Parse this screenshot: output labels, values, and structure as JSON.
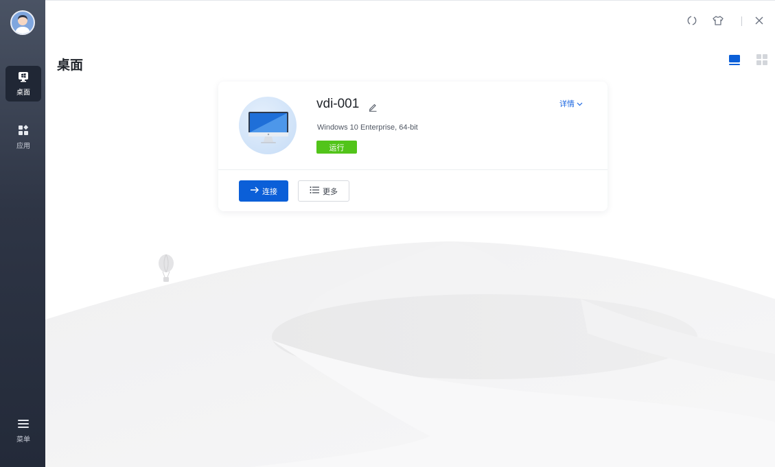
{
  "sidebar": {
    "items": [
      {
        "label": "桌面",
        "icon": "desktop-icon",
        "active": true
      },
      {
        "label": "应用",
        "icon": "apps-icon",
        "active": false
      },
      {
        "label": "菜单",
        "icon": "menu-icon",
        "active": false
      }
    ]
  },
  "topbar": {
    "icons": [
      "refresh-icon",
      "theme-shirt-icon",
      "close-icon"
    ]
  },
  "main": {
    "title": "桌面",
    "view_modes": [
      "list-view-icon",
      "grid-view-icon"
    ],
    "active_view": "list-view-icon"
  },
  "desktop_card": {
    "name": "vdi-001",
    "os": "Windows 10 Enterprise, 64-bit",
    "status": "运行",
    "details_label": "详情",
    "connect_label": "连接",
    "more_label": "更多"
  },
  "colors": {
    "accent": "#0b5fd8",
    "status_running": "#52c41a",
    "link": "#1a66e0",
    "sidebar_top": "#4a5364",
    "sidebar_bottom": "#232a39"
  }
}
